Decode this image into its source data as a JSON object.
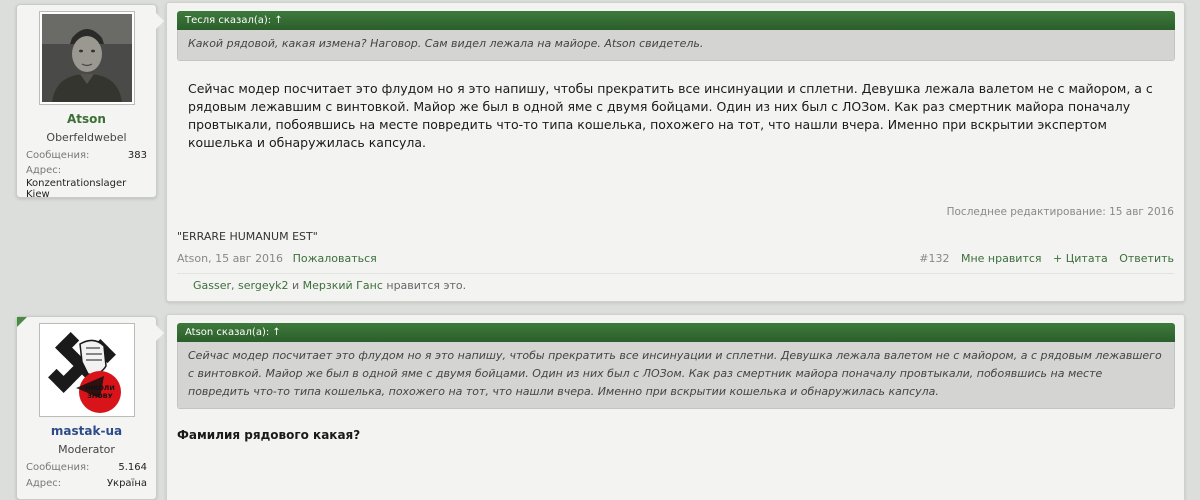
{
  "posts": [
    {
      "user": {
        "name": "Atson",
        "name_color": "#3b6f37",
        "title": "Oberfeldwebel",
        "messages_label": "Сообщения:",
        "messages_count": "383",
        "address_label": "Адрес:",
        "address": "Konzentrationslager Kiew",
        "avatar_icon": "soldier-photo"
      },
      "quote": {
        "header": "Тесля сказал(а): ↑",
        "text": "Какой рядовой, какая измена? Наговор. Сам видел лежала на майоре. Atson свидетель."
      },
      "body": "Сейчас модер посчитает это флудом но я это напишу, чтобы прекратить все инсинуации и сплетни. Девушка лежала валетом не с майором, а с рядовым лежавшим с винтовкой. Майор же был в одной яме с двумя бойцами. Один из них был с ЛОЗом. Как раз смертник майора поначалу провтыкали, побоявшись на месте повредить что-то типа кошелька, похожего на тот, что нашли вчера. Именно при вскрытии экспертом кошелька и обнаружилась капсула.",
      "edited": "Последнее редактирование: 15 авг 2016",
      "signature": "\"ERRARE HUMANUM EST\"",
      "meta": {
        "author_date": "Atson, 15 авг 2016",
        "report": "Пожаловаться",
        "post_number": "#132",
        "like": "Мне нравится",
        "quote": "+ Цитата",
        "reply": "Ответить"
      },
      "likes": {
        "user1": "Gasser",
        "sep1": ", ",
        "user2": "sergeyk2",
        "sep2": " и ",
        "user3": "Мерзкий Ганс",
        "suffix": " нравится это."
      }
    },
    {
      "user": {
        "name": "mastak-ua",
        "name_color": "#2d4a8a",
        "title": "Moderator",
        "messages_label": "Сообщения:",
        "messages_count": "5.164",
        "address_label": "Адрес:",
        "address": "Україна",
        "avatar_icon": "fist-emblem",
        "avatar_text": "НІКОЛИ ЗНОВУ"
      },
      "quote": {
        "header": "Atson сказал(а): ↑",
        "text": "Сейчас модер посчитает это флудом но я это напишу, чтобы прекратить все инсинуации и сплетни. Девушка лежала валетом не с майором, а с рядовым лежавшего с винтовкой. Майор же был в одной яме с двумя бойцами. Один из них был с ЛОЗом. Как раз смертник майора поначалу провтыкали, побоявшись на месте повредить что-то типа кошелька, похожего на тот, что нашли вчера. Именно при вскрытии кошелька и обнаружилась капсула."
      },
      "body": "Фамилия рядового какая?"
    }
  ]
}
